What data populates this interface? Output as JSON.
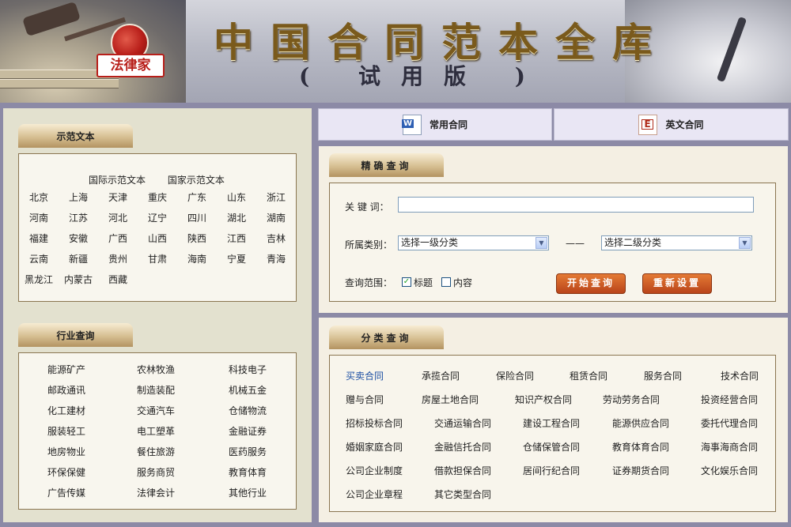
{
  "banner": {
    "title": "中国合同范本全库",
    "subtitle": "( 试用版 )",
    "logo_text": "法律家"
  },
  "left": {
    "demo_header": "示范文本",
    "demo_links": [
      "国际示范文本",
      "国家示范文本"
    ],
    "cities": [
      [
        "北京",
        "上海",
        "天津",
        "重庆",
        "广东",
        "山东",
        "浙江"
      ],
      [
        "河南",
        "江苏",
        "河北",
        "辽宁",
        "四川",
        "湖北",
        "湖南"
      ],
      [
        "福建",
        "安徽",
        "广西",
        "山西",
        "陕西",
        "江西",
        "吉林"
      ],
      [
        "云南",
        "新疆",
        "贵州",
        "甘肃",
        "海南",
        "宁夏",
        "青海"
      ],
      [
        "黑龙江",
        "内蒙古",
        "西藏"
      ]
    ],
    "industry_header": "行业查询",
    "industries": [
      [
        "能源矿产",
        "农林牧渔",
        "科技电子"
      ],
      [
        "邮政通讯",
        "制造装配",
        "机械五金"
      ],
      [
        "化工建材",
        "交通汽车",
        "仓储物流"
      ],
      [
        "服装轻工",
        "电工塑革",
        "金融证券"
      ],
      [
        "地房物业",
        "餐住旅游",
        "医药服务"
      ],
      [
        "环保保健",
        "服务商贸",
        "教育体育"
      ],
      [
        "广告传媒",
        "法律会计",
        "其他行业"
      ]
    ]
  },
  "tabs": [
    {
      "label": "常用合同",
      "icon": "word-doc-icon"
    },
    {
      "label": "英文合同",
      "icon": "english-doc-icon"
    }
  ],
  "search": {
    "header": "精确查询",
    "keyword_label": "关 键 词：",
    "keyword_value": "",
    "category_label": "所属类别：",
    "level1_selected": "选择一级分类",
    "separator": "——",
    "level2_selected": "选择二级分类",
    "scope_label": "查询范围：",
    "scope_title": "标题",
    "scope_title_checked": true,
    "scope_content": "内容",
    "scope_content_checked": false,
    "search_button": "开始查询",
    "reset_button": "重新设置"
  },
  "categories": {
    "header": "分类查询",
    "active": "买卖合同",
    "rows": [
      [
        "买卖合同",
        "承揽合同",
        "保险合同",
        "租赁合同",
        "服务合同",
        "技术合同"
      ],
      [
        "赠与合同",
        "房屋土地合同",
        "知识产权合同",
        "劳动劳务合同",
        "投资经营合同"
      ],
      [
        "招标投标合同",
        "交通运输合同",
        "建设工程合同",
        "能源供应合同",
        "委托代理合同"
      ],
      [
        "婚姻家庭合同",
        "金融信托合同",
        "仓储保管合同",
        "教育体育合同",
        "海事海商合同"
      ],
      [
        "公司企业制度",
        "借款担保合同",
        "居间行纪合同",
        "证券期货合同",
        "文化娱乐合同"
      ],
      [
        "公司企业章程",
        "其它类型合同"
      ]
    ]
  }
}
